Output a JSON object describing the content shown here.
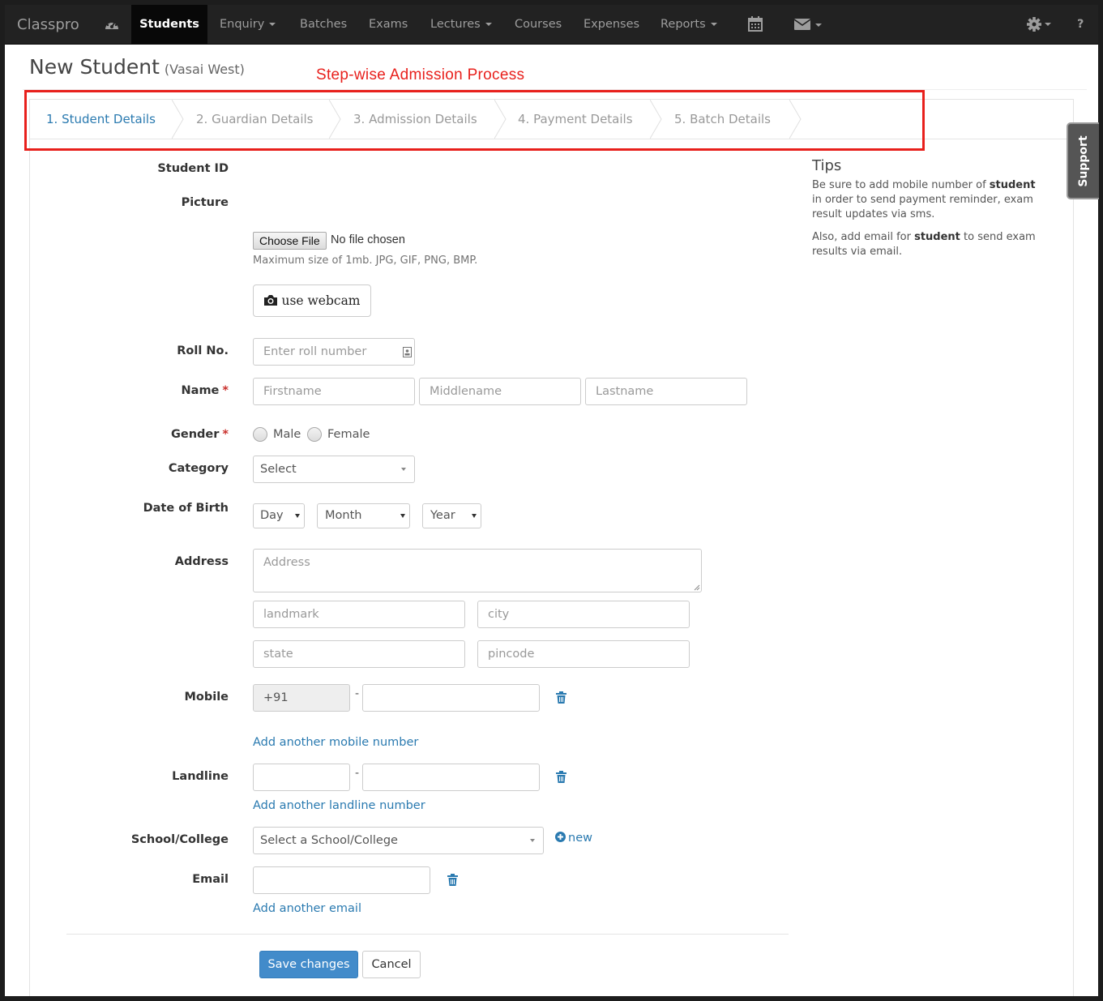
{
  "navbar": {
    "brand": "Classpro",
    "items": [
      {
        "label": "Students",
        "active": true
      },
      {
        "label": "Enquiry",
        "dropdown": true
      },
      {
        "label": "Batches"
      },
      {
        "label": "Exams"
      },
      {
        "label": "Lectures",
        "dropdown": true
      },
      {
        "label": "Courses"
      },
      {
        "label": "Expenses"
      },
      {
        "label": "Reports",
        "dropdown": true
      }
    ],
    "help_label": "?",
    "icons": [
      "dashboard-icon",
      "calendar-icon",
      "envelope-icon",
      "gear-icon"
    ]
  },
  "page": {
    "title": "New Student",
    "branch": "(Vasai West)"
  },
  "annotation": {
    "text": "Step-wise Admission Process",
    "color": "#e8201c"
  },
  "steps": [
    {
      "label": "1. Student Details",
      "active": true
    },
    {
      "label": "2. Guardian Details"
    },
    {
      "label": "3. Admission Details"
    },
    {
      "label": "4. Payment Details"
    },
    {
      "label": "5. Batch Details"
    }
  ],
  "form": {
    "student_id_label": "Student ID",
    "picture_label": "Picture",
    "choose_file_label": "Choose File",
    "no_file_text": "No file chosen",
    "file_help": "Maximum size of 1mb. JPG, GIF, PNG, BMP.",
    "webcam_label": "use webcam",
    "roll_label": "Roll No.",
    "roll_placeholder": "Enter roll number",
    "name_label": "Name",
    "required_mark": "*",
    "firstname_placeholder": "Firstname",
    "middlename_placeholder": "Middlename",
    "lastname_placeholder": "Lastname",
    "gender_label": "Gender",
    "gender_options": [
      "Male",
      "Female"
    ],
    "category_label": "Category",
    "category_value": "Select",
    "dob_label": "Date of Birth",
    "dob_day": "Day",
    "dob_month": "Month",
    "dob_year": "Year",
    "address_label": "Address",
    "address_placeholder": "Address",
    "landmark_placeholder": "landmark",
    "city_placeholder": "city",
    "state_placeholder": "state",
    "pincode_placeholder": "pincode",
    "mobile_label": "Mobile",
    "country_code": "+91",
    "separator": "-",
    "add_mobile": "Add another mobile number",
    "landline_label": "Landline",
    "add_landline": "Add another landline number",
    "school_label": "School/College",
    "school_value": "Select a School/College",
    "new_label": "new",
    "email_label": "Email",
    "add_email": "Add another email",
    "save_label": "Save changes",
    "cancel_label": "Cancel"
  },
  "tips": {
    "title": "Tips",
    "p1_a": "Be sure to add mobile number of ",
    "p1_b": "student",
    "p1_c": " in order to send payment reminder, exam result updates via sms.",
    "p2_a": "Also, add email for ",
    "p2_b": "student",
    "p2_c": " to send exam results via email."
  },
  "support_tab": "Support",
  "colors": {
    "navbar": "#222222",
    "link": "#2a7ab0",
    "primary": "#428bca",
    "annotation": "#e8201c"
  }
}
